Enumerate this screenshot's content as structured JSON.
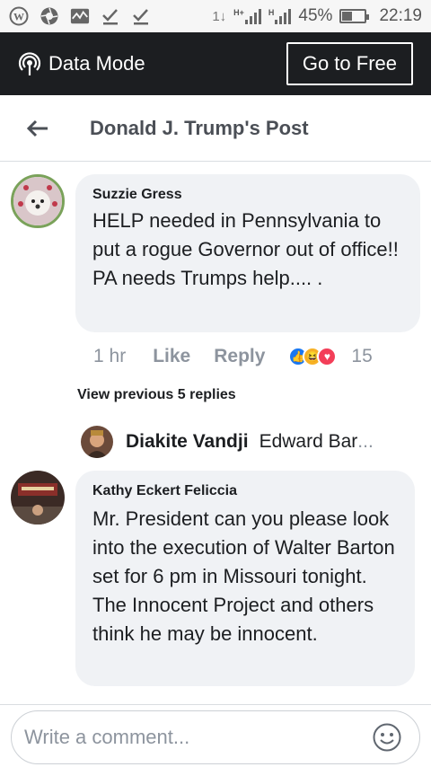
{
  "status_bar": {
    "battery": "45%",
    "battery_level": 0.45,
    "time": "22:19",
    "network1": "H+",
    "network2": "H"
  },
  "data_mode": {
    "label": "Data Mode",
    "button": "Go to Free"
  },
  "header": {
    "title": "Donald J. Trump's Post"
  },
  "comments": [
    {
      "author": "Suzzie Gress",
      "text": "HELP needed in Pennsylvania to put a rogue Governor out of office!! PA needs Trumps help.... .",
      "time": "1 hr",
      "like": "Like",
      "reply": "Reply",
      "reactions": "15"
    },
    {
      "author": "Kathy Eckert Feliccia",
      "text": "Mr. President can you please look into the execution of Walter Barton set for 6 pm in Missouri tonight.  The Innocent Project and others think he may be innocent."
    }
  ],
  "view_previous": "View previous 5 replies",
  "reply_preview": {
    "author": "Diakite Vandji",
    "snippet": "Edward Bar",
    "ellipsis": "..."
  },
  "composer": {
    "placeholder": "Write a comment..."
  },
  "colors": {
    "data_bar": "#1c1e21",
    "bubble": "#f0f2f5",
    "muted_text": "#8d949e",
    "like_blue": "#1877f2",
    "haha_yellow": "#f7b125",
    "love_red": "#f33e58"
  }
}
